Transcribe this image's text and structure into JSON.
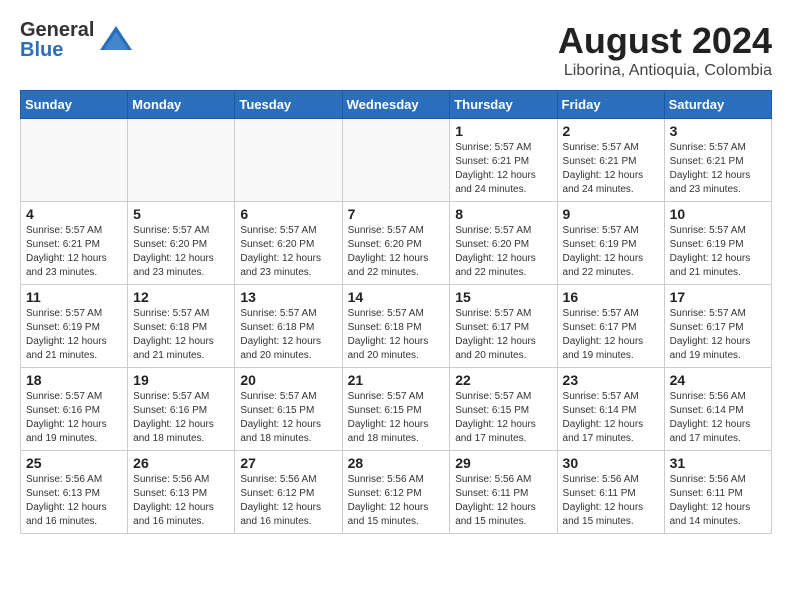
{
  "header": {
    "logo_general": "General",
    "logo_blue": "Blue",
    "month_title": "August 2024",
    "location": "Liborina, Antioquia, Colombia"
  },
  "weekdays": [
    "Sunday",
    "Monday",
    "Tuesday",
    "Wednesday",
    "Thursday",
    "Friday",
    "Saturday"
  ],
  "weeks": [
    [
      {
        "day": "",
        "info": ""
      },
      {
        "day": "",
        "info": ""
      },
      {
        "day": "",
        "info": ""
      },
      {
        "day": "",
        "info": ""
      },
      {
        "day": "1",
        "info": "Sunrise: 5:57 AM\nSunset: 6:21 PM\nDaylight: 12 hours\nand 24 minutes."
      },
      {
        "day": "2",
        "info": "Sunrise: 5:57 AM\nSunset: 6:21 PM\nDaylight: 12 hours\nand 24 minutes."
      },
      {
        "day": "3",
        "info": "Sunrise: 5:57 AM\nSunset: 6:21 PM\nDaylight: 12 hours\nand 23 minutes."
      }
    ],
    [
      {
        "day": "4",
        "info": "Sunrise: 5:57 AM\nSunset: 6:21 PM\nDaylight: 12 hours\nand 23 minutes."
      },
      {
        "day": "5",
        "info": "Sunrise: 5:57 AM\nSunset: 6:20 PM\nDaylight: 12 hours\nand 23 minutes."
      },
      {
        "day": "6",
        "info": "Sunrise: 5:57 AM\nSunset: 6:20 PM\nDaylight: 12 hours\nand 23 minutes."
      },
      {
        "day": "7",
        "info": "Sunrise: 5:57 AM\nSunset: 6:20 PM\nDaylight: 12 hours\nand 22 minutes."
      },
      {
        "day": "8",
        "info": "Sunrise: 5:57 AM\nSunset: 6:20 PM\nDaylight: 12 hours\nand 22 minutes."
      },
      {
        "day": "9",
        "info": "Sunrise: 5:57 AM\nSunset: 6:19 PM\nDaylight: 12 hours\nand 22 minutes."
      },
      {
        "day": "10",
        "info": "Sunrise: 5:57 AM\nSunset: 6:19 PM\nDaylight: 12 hours\nand 21 minutes."
      }
    ],
    [
      {
        "day": "11",
        "info": "Sunrise: 5:57 AM\nSunset: 6:19 PM\nDaylight: 12 hours\nand 21 minutes."
      },
      {
        "day": "12",
        "info": "Sunrise: 5:57 AM\nSunset: 6:18 PM\nDaylight: 12 hours\nand 21 minutes."
      },
      {
        "day": "13",
        "info": "Sunrise: 5:57 AM\nSunset: 6:18 PM\nDaylight: 12 hours\nand 20 minutes."
      },
      {
        "day": "14",
        "info": "Sunrise: 5:57 AM\nSunset: 6:18 PM\nDaylight: 12 hours\nand 20 minutes."
      },
      {
        "day": "15",
        "info": "Sunrise: 5:57 AM\nSunset: 6:17 PM\nDaylight: 12 hours\nand 20 minutes."
      },
      {
        "day": "16",
        "info": "Sunrise: 5:57 AM\nSunset: 6:17 PM\nDaylight: 12 hours\nand 19 minutes."
      },
      {
        "day": "17",
        "info": "Sunrise: 5:57 AM\nSunset: 6:17 PM\nDaylight: 12 hours\nand 19 minutes."
      }
    ],
    [
      {
        "day": "18",
        "info": "Sunrise: 5:57 AM\nSunset: 6:16 PM\nDaylight: 12 hours\nand 19 minutes."
      },
      {
        "day": "19",
        "info": "Sunrise: 5:57 AM\nSunset: 6:16 PM\nDaylight: 12 hours\nand 18 minutes."
      },
      {
        "day": "20",
        "info": "Sunrise: 5:57 AM\nSunset: 6:15 PM\nDaylight: 12 hours\nand 18 minutes."
      },
      {
        "day": "21",
        "info": "Sunrise: 5:57 AM\nSunset: 6:15 PM\nDaylight: 12 hours\nand 18 minutes."
      },
      {
        "day": "22",
        "info": "Sunrise: 5:57 AM\nSunset: 6:15 PM\nDaylight: 12 hours\nand 17 minutes."
      },
      {
        "day": "23",
        "info": "Sunrise: 5:57 AM\nSunset: 6:14 PM\nDaylight: 12 hours\nand 17 minutes."
      },
      {
        "day": "24",
        "info": "Sunrise: 5:56 AM\nSunset: 6:14 PM\nDaylight: 12 hours\nand 17 minutes."
      }
    ],
    [
      {
        "day": "25",
        "info": "Sunrise: 5:56 AM\nSunset: 6:13 PM\nDaylight: 12 hours\nand 16 minutes."
      },
      {
        "day": "26",
        "info": "Sunrise: 5:56 AM\nSunset: 6:13 PM\nDaylight: 12 hours\nand 16 minutes."
      },
      {
        "day": "27",
        "info": "Sunrise: 5:56 AM\nSunset: 6:12 PM\nDaylight: 12 hours\nand 16 minutes."
      },
      {
        "day": "28",
        "info": "Sunrise: 5:56 AM\nSunset: 6:12 PM\nDaylight: 12 hours\nand 15 minutes."
      },
      {
        "day": "29",
        "info": "Sunrise: 5:56 AM\nSunset: 6:11 PM\nDaylight: 12 hours\nand 15 minutes."
      },
      {
        "day": "30",
        "info": "Sunrise: 5:56 AM\nSunset: 6:11 PM\nDaylight: 12 hours\nand 15 minutes."
      },
      {
        "day": "31",
        "info": "Sunrise: 5:56 AM\nSunset: 6:11 PM\nDaylight: 12 hours\nand 14 minutes."
      }
    ]
  ]
}
